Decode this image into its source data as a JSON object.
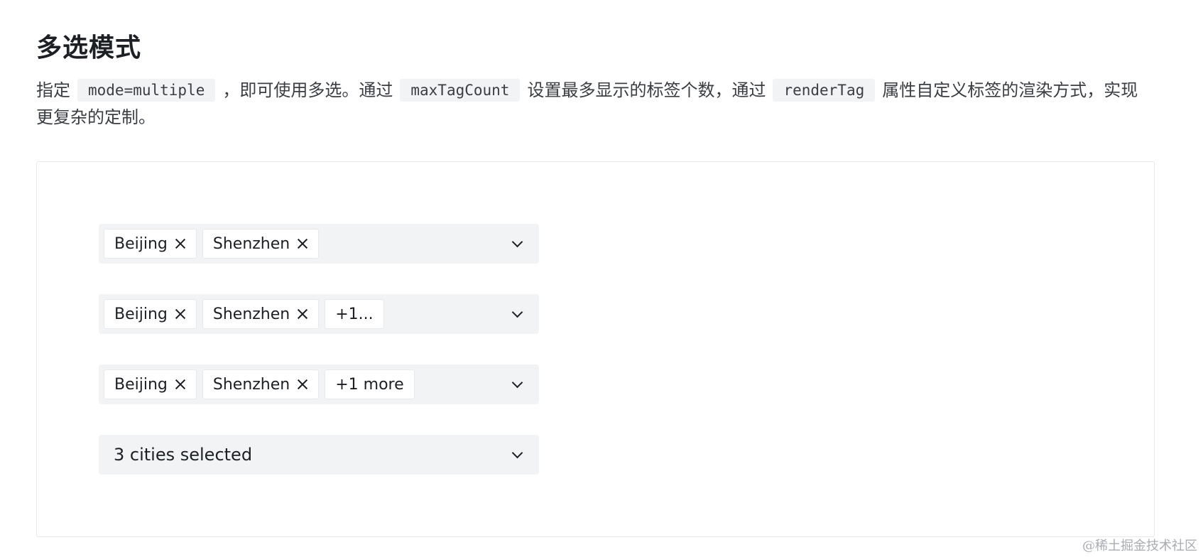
{
  "title": "多选模式",
  "description": {
    "part1": "指定",
    "code1": "mode=multiple",
    "part2": "，即可使用多选。通过",
    "code2": "maxTagCount",
    "part3": "设置最多显示的标签个数，通过",
    "code3": "renderTag",
    "part4": "属性自定义标签的渲染方式，实现更复杂的定制。"
  },
  "selects": [
    {
      "tags": [
        "Beijing",
        "Shenzhen"
      ]
    },
    {
      "tags": [
        "Beijing",
        "Shenzhen"
      ],
      "overflow": "+1..."
    },
    {
      "tags": [
        "Beijing",
        "Shenzhen"
      ],
      "overflow": "+1 more"
    },
    {
      "summary": "3 cities selected"
    }
  ],
  "watermark": "@稀土掘金技术社区",
  "colors": {
    "select_bg": "#f2f3f5",
    "tag_bg": "#ffffff",
    "text": "#1c1f23",
    "border": "#e6e8ea"
  }
}
